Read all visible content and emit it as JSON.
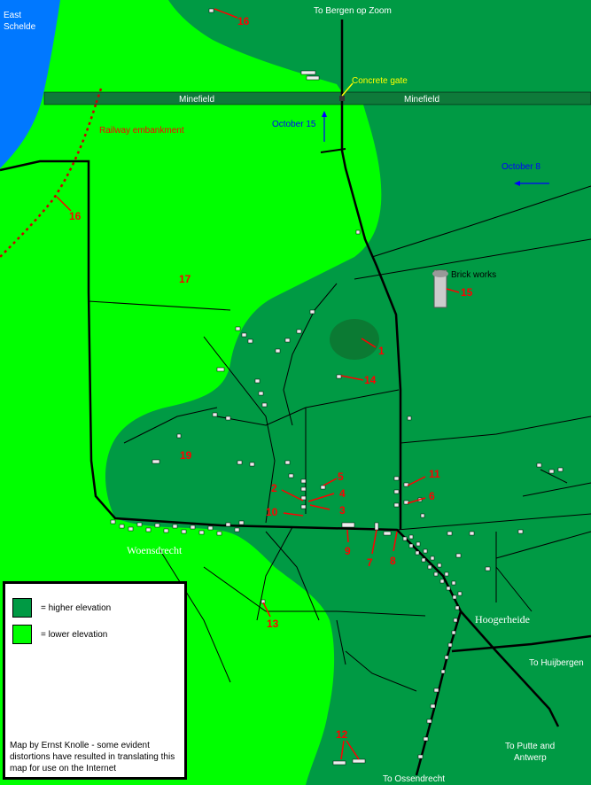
{
  "colors": {
    "low": "#00ff00",
    "high": "#009a44",
    "high_dark": "#0b7a33",
    "sea": "#0078ff",
    "minefield_band": "#0e7a3a",
    "road": "#000000",
    "marker": "#ff0000",
    "arrow": "#0000ff",
    "gate": "#ffff00"
  },
  "labels": {
    "sea": "East\nSchelde",
    "to_bergen": "To Bergen op Zoom",
    "concrete_gate": "Concrete gate",
    "minefield_left": "Minefield",
    "minefield_right": "Minefield",
    "railway": "Railway embankment",
    "october15": "October 15",
    "october8": "October 8",
    "brick_works": "Brick works",
    "woensdrecht": "Woensdrecht",
    "hoogerheide": "Hoogerheide",
    "to_huijbergen": "To Huijbergen",
    "to_putte": "To Putte and\nAntwerp",
    "to_ossendrecht": "To Ossendrecht"
  },
  "markers": [
    "16",
    "16",
    "17",
    "15",
    "1",
    "14",
    "19",
    "5",
    "2",
    "4",
    "3",
    "10",
    "11",
    "6",
    "9",
    "7",
    "8",
    "13",
    "12"
  ],
  "legend": {
    "higher": "= higher elevation",
    "lower": "= lower elevation",
    "credit": "Map by Ernst Knolle - some evident distortions have resulted in translating this map for use on the Internet"
  }
}
